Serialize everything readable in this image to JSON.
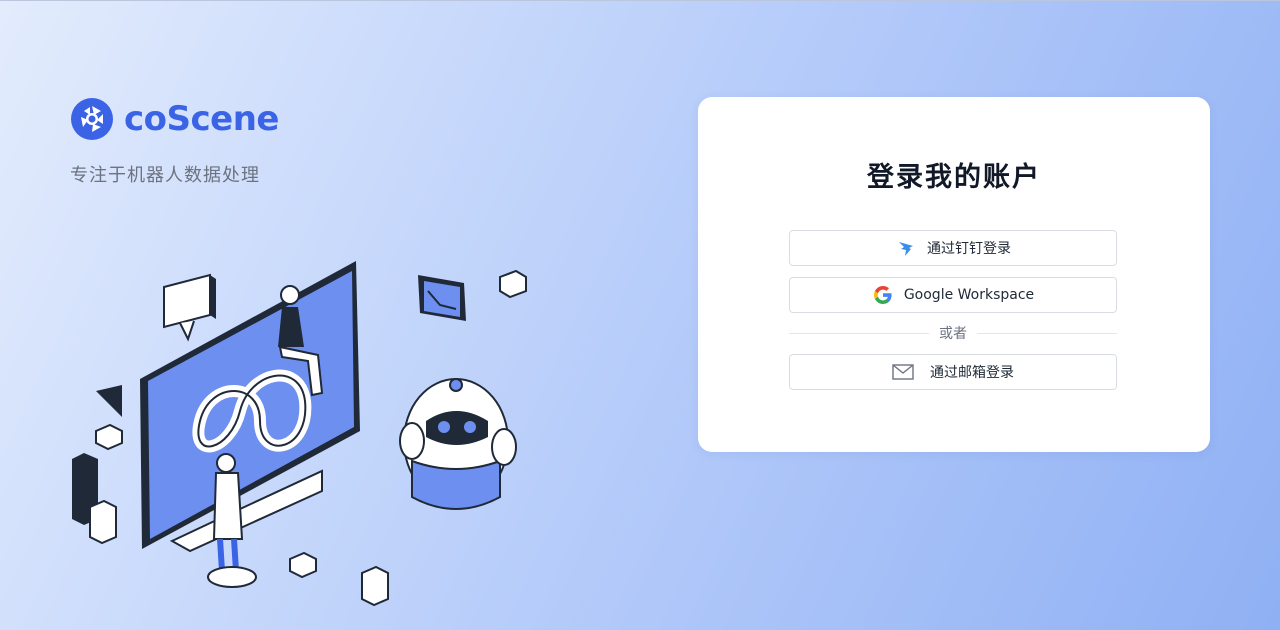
{
  "brand": {
    "name": "coScene",
    "tagline": "专注于机器人数据处理",
    "accent_color": "#3b63e6"
  },
  "login": {
    "title": "登录我的账户",
    "dingtalk_label": "通过钉钉登录",
    "google_label": "Google Workspace",
    "divider_label": "或者",
    "email_label": "通过邮箱登录"
  },
  "icons": {
    "dingtalk": "dingtalk-icon",
    "google": "google-icon",
    "email": "mail-icon"
  }
}
